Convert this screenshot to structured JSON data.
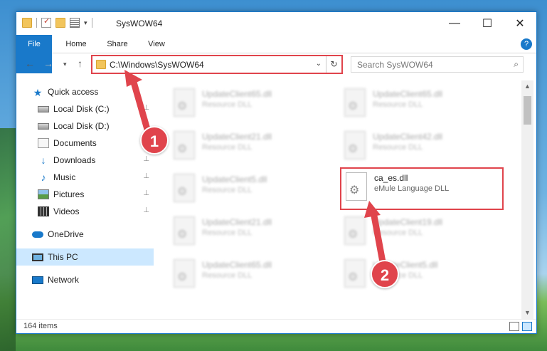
{
  "window": {
    "title": "SysWOW64",
    "controls": {
      "minimize": "—",
      "maximize": "☐",
      "close": "✕"
    }
  },
  "qat": {
    "dropdown_glyph": "▾"
  },
  "ribbon": {
    "tabs": [
      {
        "label": "File"
      },
      {
        "label": "Home"
      },
      {
        "label": "Share"
      },
      {
        "label": "View"
      }
    ],
    "help_glyph": "?"
  },
  "nav": {
    "back_glyph": "←",
    "forward_glyph": "→",
    "recent_glyph": "▾",
    "up_glyph": "↑",
    "address": "C:\\Windows\\SysWOW64",
    "address_dropdown_glyph": "⌄",
    "refresh_glyph": "↻",
    "search_placeholder": "Search SysWOW64",
    "search_glyph": "⌕"
  },
  "sidebar": {
    "items": [
      {
        "label": "Quick access",
        "icon": "star-icon"
      },
      {
        "label": "Local Disk (C:)",
        "icon": "disk-icon"
      },
      {
        "label": "Local Disk (D:)",
        "icon": "disk-icon"
      },
      {
        "label": "Documents",
        "icon": "documents-icon"
      },
      {
        "label": "Downloads",
        "icon": "download-icon"
      },
      {
        "label": "Music",
        "icon": "music-icon"
      },
      {
        "label": "Pictures",
        "icon": "pictures-icon"
      },
      {
        "label": "Videos",
        "icon": "videos-icon"
      },
      {
        "label": "OneDrive",
        "icon": "cloud-icon"
      },
      {
        "label": "This PC",
        "icon": "computer-icon",
        "selected": true
      },
      {
        "label": "Network",
        "icon": "network-icon"
      }
    ],
    "pin_glyph": "📌"
  },
  "files": [
    {
      "name": "UpdateClient65.dll",
      "type": "Resource DLL"
    },
    {
      "name": "UpdateClient65.dll",
      "type": "Resource DLL"
    },
    {
      "name": "UpdateClient21.dll",
      "type": "Resource DLL"
    },
    {
      "name": "UpdateClient42.dll",
      "type": "Resource DLL"
    },
    {
      "name": "UpdateClient5.dll",
      "type": "Resource DLL"
    },
    {
      "name": "ca_es.dll",
      "type": "eMule Language DLL"
    },
    {
      "name": "UpdateClient21.dll",
      "type": "Resource DLL"
    },
    {
      "name": "UpdateClient19.dll",
      "type": "Resource DLL"
    },
    {
      "name": "UpdateClient65.dll",
      "type": "Resource DLL"
    },
    {
      "name": "UpdateClient5.dll",
      "type": "Resource DLL"
    }
  ],
  "status": {
    "count": "164 items"
  },
  "annotations": {
    "step1": "1",
    "step2": "2"
  },
  "colors": {
    "accent": "#1979ca",
    "highlight": "#e0444c"
  }
}
